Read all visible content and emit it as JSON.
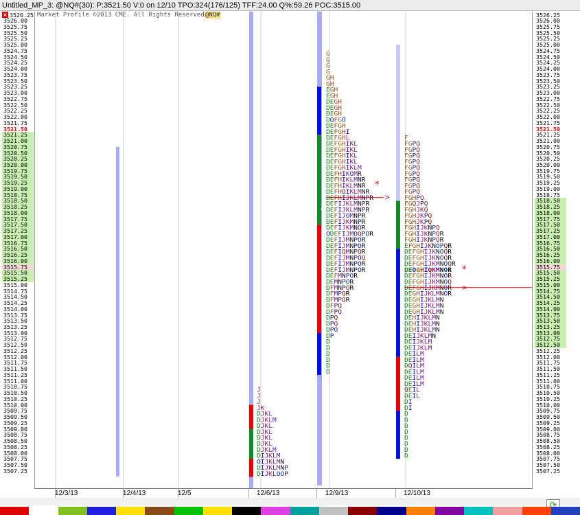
{
  "window": {
    "title": "Untitled_MP_3: @NQ#(30): P:3521.50 V:0 on 12/10 TPO:324(176/125)  TFF:24.00 Q%:59.26 POC:3515.00"
  },
  "chart": {
    "copyright": "Market Profile ©2013 CME. All Rights Reserved",
    "symbol_tag": "@NQ#",
    "last_price": "3521.50",
    "poc_price": "3515.75"
  },
  "price_axis": {
    "top_price": 3526.25,
    "tick": 0.25,
    "labels": [
      "3526.25",
      "3526.00",
      "3525.75",
      "3525.50",
      "3525.25",
      "3525.00",
      "3524.75",
      "3524.50",
      "3524.25",
      "3524.00",
      "3523.75",
      "3523.50",
      "3523.25",
      "3523.00",
      "3522.75",
      "3522.50",
      "3522.25",
      "3522.00",
      "3521.75",
      "3521.50",
      "3521.25",
      "3521.00",
      "3520.75",
      "3520.50",
      "3520.25",
      "3520.00",
      "3519.75",
      "3519.50",
      "3519.25",
      "3519.00",
      "3518.75",
      "3518.50",
      "3518.25",
      "3518.00",
      "3517.75",
      "3517.50",
      "3517.25",
      "3517.00",
      "3516.75",
      "3516.50",
      "3516.25",
      "3516.00",
      "3515.75",
      "3515.50",
      "3515.25",
      "3515.00",
      "3514.75",
      "3514.50",
      "3514.25",
      "3514.00",
      "3513.75",
      "3513.50",
      "3513.25",
      "3513.00",
      "3512.75",
      "3512.50",
      "3512.25",
      "3512.00",
      "3511.75",
      "3511.50",
      "3511.25",
      "3511.00",
      "3510.75",
      "3510.50",
      "3510.25",
      "3510.00",
      "3509.75",
      "3509.50",
      "3509.25",
      "3509.00",
      "3508.75",
      "3508.50",
      "3508.25",
      "3508.00",
      "3507.75",
      "3507.50",
      "3507.25"
    ]
  },
  "date_axis": {
    "labels": [
      "12/3/13",
      "12/4/13",
      "12/5",
      "12/6/13",
      "12/9/13",
      "12/10/13"
    ]
  },
  "colors": {
    "va_green": "#c8eeb0",
    "last_red": "#e00000",
    "poc_pink": "#f6d4d8",
    "range_bar": "#a8acf8",
    "blue": "#0010e0",
    "green": "#108a28",
    "red": "#e80000"
  },
  "palette": {
    "D": "#1c8a20",
    "E": "#2c8a20",
    "F": "#8a5a20",
    "G": "#9a5a18",
    "H": "#a04a18",
    "I": "#0000c0",
    "J": "#a02060",
    "K": "#8a1a7a",
    "L": "#7a1a80",
    "M": "#6a1a90",
    "N": "#101010",
    "O": "#0a2aa0",
    "P": "#1a1a8a",
    "Q": "#7a1a1a",
    "R": "#000000"
  },
  "profiles": [
    {
      "day": "12/6/13",
      "rows": [
        [
          "3510.75",
          "J"
        ],
        [
          "3510.50",
          "J"
        ],
        [
          "3510.25",
          "J"
        ],
        [
          "3510.00",
          "JK"
        ],
        [
          "3509.75",
          "DJKL"
        ],
        [
          "3509.50",
          "DJKLM"
        ],
        [
          "3509.25",
          "DJKL"
        ],
        [
          "3509.00",
          "DJKL"
        ],
        [
          "3508.75",
          "DJKL"
        ],
        [
          "3508.50",
          "DJKL"
        ],
        [
          "3508.25",
          "DJKLM"
        ],
        [
          "3508.00",
          "DIJKLM"
        ],
        [
          "3507.75",
          "OIJKLMN"
        ],
        [
          "3507.50",
          "DIJKLMNP"
        ],
        [
          "3507.25",
          "DIJKLOOP"
        ]
      ]
    },
    {
      "day": "12/9/13",
      "rows": [
        [
          "3524.75",
          "G"
        ],
        [
          "3524.50",
          "G"
        ],
        [
          "3524.25",
          "G"
        ],
        [
          "3524.00",
          "G"
        ],
        [
          "3523.75",
          "GH"
        ],
        [
          "3523.50",
          "GH"
        ],
        [
          "3523.25",
          "EGH"
        ],
        [
          "3523.00",
          "EGH"
        ],
        [
          "3522.75",
          "DEGH"
        ],
        [
          "3522.50",
          "DEGH"
        ],
        [
          "3522.25",
          "DEGH"
        ],
        [
          "3522.00",
          "DOFGO"
        ],
        [
          "3521.75",
          "DEFGH"
        ],
        [
          "3521.50",
          "DEFGHI"
        ],
        [
          "3521.25",
          "DEFGHL"
        ],
        [
          "3521.00",
          "DEFGHIKL"
        ],
        [
          "3520.75",
          "DEFGHIKL"
        ],
        [
          "3520.50",
          "DEFGHIKL"
        ],
        [
          "3520.25",
          "DEFGHIKL"
        ],
        [
          "3520.00",
          "DEFGHIKLM"
        ],
        [
          "3519.75",
          "DEFHIKOMR"
        ],
        [
          "3519.50",
          "DEFHIKLMNR"
        ],
        [
          "3519.25",
          "DEFHIKLMNR"
        ],
        [
          "3519.00",
          "DEFHQIKLMNR"
        ],
        [
          "3518.75",
          "DEFHIJKLMNPR"
        ],
        [
          "3518.50",
          "DEFIJKLMNPR"
        ],
        [
          "3518.25",
          "DEFIJKLMNPR"
        ],
        [
          "3518.00",
          "DEFIJOMNPR"
        ],
        [
          "3517.75",
          "DEFIJKMNPR"
        ],
        [
          "3517.50",
          "DEFIJKMNOR"
        ],
        [
          "3517.25",
          "ODEFIJMOQPOR"
        ],
        [
          "3517.00",
          "DEFIJMNPOR"
        ],
        [
          "3516.75",
          "DEFIJMNPOR"
        ],
        [
          "3516.50",
          "DEFIQMNPQR"
        ],
        [
          "3516.25",
          "DEFIJMNPOQ"
        ],
        [
          "3516.00",
          "DEFIJMNPOR"
        ],
        [
          "3515.75",
          "DEFIJMNPOR"
        ],
        [
          "3515.50",
          "DEFMNPOR"
        ],
        [
          "3515.25",
          "DEMNPOR"
        ],
        [
          "3515.00",
          "DFMNPQR"
        ],
        [
          "3514.75",
          "DFMPQR"
        ],
        [
          "3514.50",
          "DFMPQR"
        ],
        [
          "3514.25",
          "DFPQ"
        ],
        [
          "3514.00",
          "DFPQ"
        ],
        [
          "3513.75",
          "DPQ"
        ],
        [
          "3513.50",
          "DPQ"
        ],
        [
          "3513.25",
          "DPO"
        ],
        [
          "3513.00",
          "DP"
        ],
        [
          "3512.75",
          "D"
        ],
        [
          "3512.50",
          "D"
        ],
        [
          "3512.25",
          "D"
        ],
        [
          "3512.00",
          "D"
        ],
        [
          "3511.75",
          "D"
        ],
        [
          "3511.50",
          "D"
        ]
      ]
    },
    {
      "day": "12/10/13",
      "rows": [
        [
          "3521.25",
          "F"
        ],
        [
          "3521.00",
          "FGPQ"
        ],
        [
          "3520.75",
          "FGPQ"
        ],
        [
          "3520.50",
          "FGPQ"
        ],
        [
          "3520.25",
          "FGPQ"
        ],
        [
          "3520.00",
          "FGPQ"
        ],
        [
          "3519.75",
          "FGPQ"
        ],
        [
          "3519.50",
          "FGPQ"
        ],
        [
          "3519.25",
          "FGPQ"
        ],
        [
          "3519.00",
          "FGPQ"
        ],
        [
          "3518.75",
          "FGHPQ"
        ],
        [
          "3518.50",
          "FGQJPQ"
        ],
        [
          "3518.25",
          "FGHJKQ"
        ],
        [
          "3518.00",
          "FGHJKPQ"
        ],
        [
          "3517.75",
          "FGHJKPQ"
        ],
        [
          "3517.50",
          "FGHIJKNPQ"
        ],
        [
          "3517.25",
          "FGHIJKNPQR"
        ],
        [
          "3517.00",
          "FGHIJKNPQR"
        ],
        [
          "3516.75",
          "EFGHIJKNOPQR"
        ],
        [
          "3516.50",
          "DEFGHIJKNOQR"
        ],
        [
          "3516.25",
          "DEFGHIJKNOQR"
        ],
        [
          "3516.00",
          "DEFGHIJKMNOQR"
        ],
        [
          "3515.75",
          "DEOGHIQKMNOR"
        ],
        [
          "3515.50",
          "DEFGHIJKMNOR"
        ],
        [
          "3515.25",
          "DEFGHIJKMNOQ"
        ],
        [
          "3515.00",
          "DEFGHIJKMNOR"
        ],
        [
          "3514.75",
          "DEGHIJKLMNOR"
        ],
        [
          "3514.50",
          "DEGHIJKLMN"
        ],
        [
          "3514.25",
          "DEGHIJKLMN"
        ],
        [
          "3514.00",
          "DEGHIJKLMN"
        ],
        [
          "3513.75",
          "DEHIJKLMN"
        ],
        [
          "3513.50",
          "DEHIJKLMN"
        ],
        [
          "3513.25",
          "DEHIJKLMN"
        ],
        [
          "3513.00",
          "DEIJKLMN"
        ],
        [
          "3512.75",
          "DEIJKLM"
        ],
        [
          "3512.50",
          "DEIJKLM"
        ],
        [
          "3512.25",
          "DEILM"
        ],
        [
          "3512.00",
          "DEILM"
        ],
        [
          "3511.75",
          "DQILM"
        ],
        [
          "3511.50",
          "DEILM"
        ],
        [
          "3511.25",
          "DEILM"
        ],
        [
          "3511.00",
          "DEILM"
        ],
        [
          "3510.75",
          "QEIL"
        ],
        [
          "3510.50",
          "DEIL"
        ],
        [
          "3510.25",
          "DI"
        ],
        [
          "3510.00",
          "DI"
        ],
        [
          "3509.75",
          "D"
        ],
        [
          "3509.50",
          "D"
        ],
        [
          "3509.25",
          "D"
        ],
        [
          "3509.00",
          "D"
        ],
        [
          "3508.75",
          "D"
        ],
        [
          "3508.50",
          "D"
        ],
        [
          "3508.25",
          "D"
        ],
        [
          "3508.00",
          "D"
        ]
      ]
    }
  ],
  "statusbar": {
    "colors": [
      "#e00000",
      "#ffffff",
      "#80c020",
      "#2020e0",
      "#ffe000",
      "#8a4a1a",
      "#00c000",
      "#ffe000",
      "#000000",
      "#e040e0",
      "#00a0a0",
      "#c0c0c0",
      "#8a0000",
      "#00008a",
      "#ff8000",
      "#8000a0",
      "#00c0c0",
      "#f0a0a0",
      "#ff4000",
      "#2040c0"
    ]
  }
}
